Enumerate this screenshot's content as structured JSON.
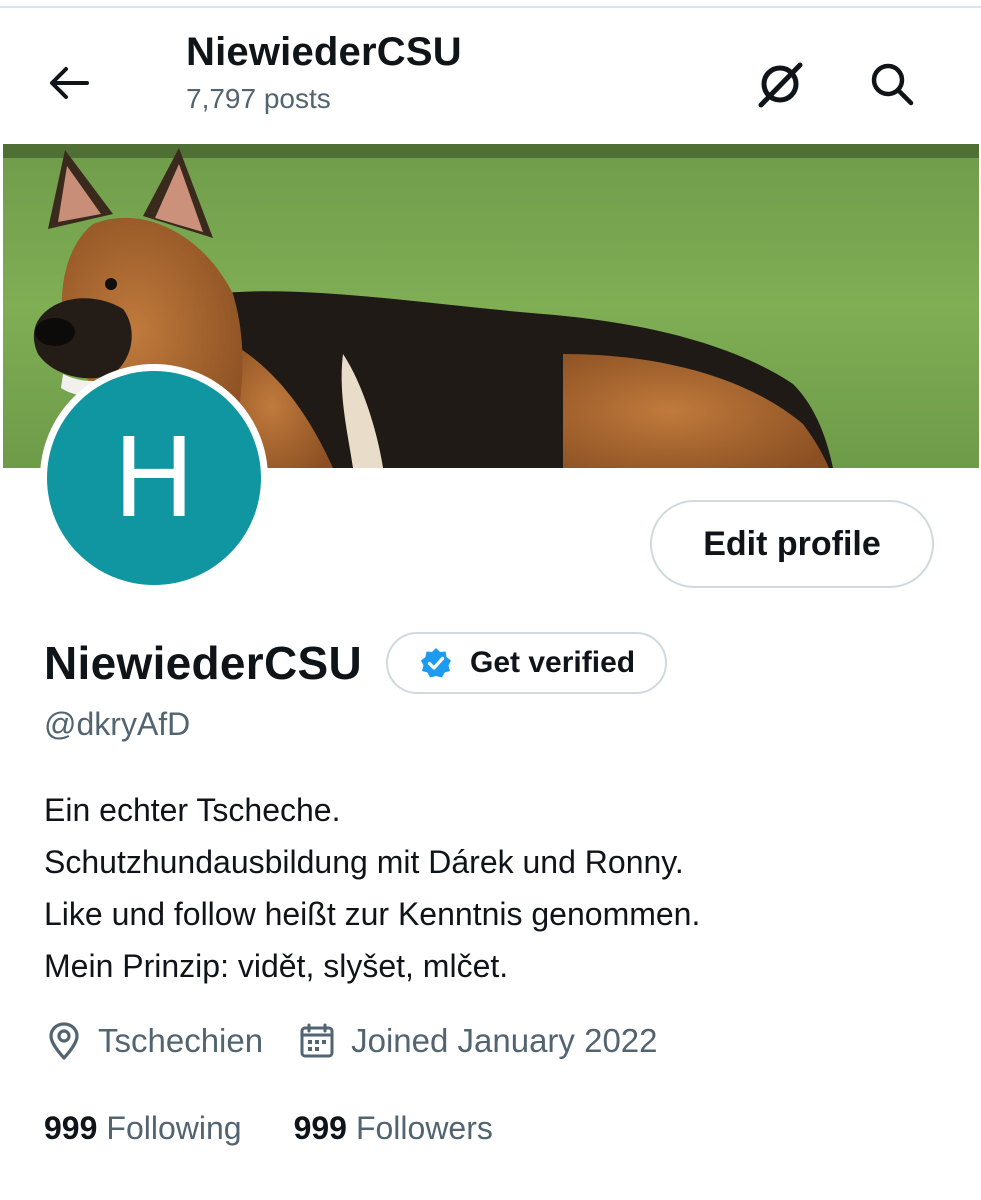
{
  "header": {
    "title": "NiewiederCSU",
    "post_count": "7,797 posts",
    "back_icon": "arrow-left-icon",
    "grok_icon": "grok-icon",
    "search_icon": "search-icon"
  },
  "profile": {
    "avatar_letter": "H",
    "avatar_color": "#0f96a0",
    "edit_button_label": "Edit profile",
    "display_name": "NiewiederCSU",
    "verify_button_label": "Get verified",
    "verify_badge_color": "#1d9bf0",
    "handle": "@dkryAfD",
    "bio_lines": [
      "Ein echter Tscheche.",
      "Schutzhundausbildung mit Dárek und Ronny.",
      "Like und follow heißt zur Kenntnis genommen.",
      "Mein Prinzip: vidět, slyšet, mlčet."
    ],
    "location": "Tschechien",
    "joined": "Joined January 2022",
    "following_count": "999",
    "following_label": "Following",
    "followers_count": "999",
    "followers_label": "Followers"
  },
  "colors": {
    "text_primary": "#0f1419",
    "text_secondary": "#536471",
    "border": "#cfd9de"
  }
}
